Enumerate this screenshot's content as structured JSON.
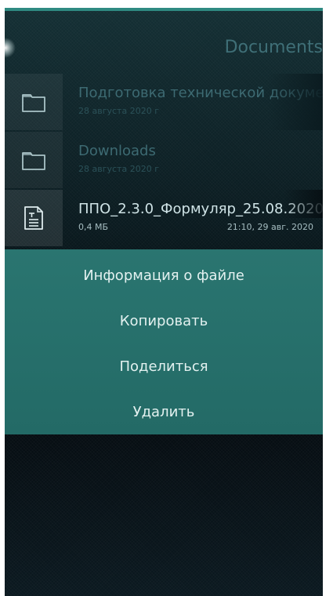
{
  "header": {
    "title": "Documents"
  },
  "files": [
    {
      "name": "Подготовка технической документации",
      "date": "28 августа 2020 г",
      "icon": "folder-icon"
    },
    {
      "name": "Downloads",
      "date": "28 августа 2020 г",
      "icon": "folder-icon"
    },
    {
      "name": "ППО_2.3.0_Формуляр_25.08.2020",
      "size": "0,4 МБ",
      "modified": "21:10, 29 авг. 2020",
      "icon": "text-document-icon"
    }
  ],
  "context_menu": {
    "items": [
      {
        "label": "Информация о файле"
      },
      {
        "label": "Копировать"
      },
      {
        "label": "Поделиться"
      },
      {
        "label": "Удалить"
      }
    ]
  },
  "colors": {
    "accent": "#2a7570",
    "dim_text": "#3d6a72",
    "highlight_text": "#cfe3e6"
  }
}
